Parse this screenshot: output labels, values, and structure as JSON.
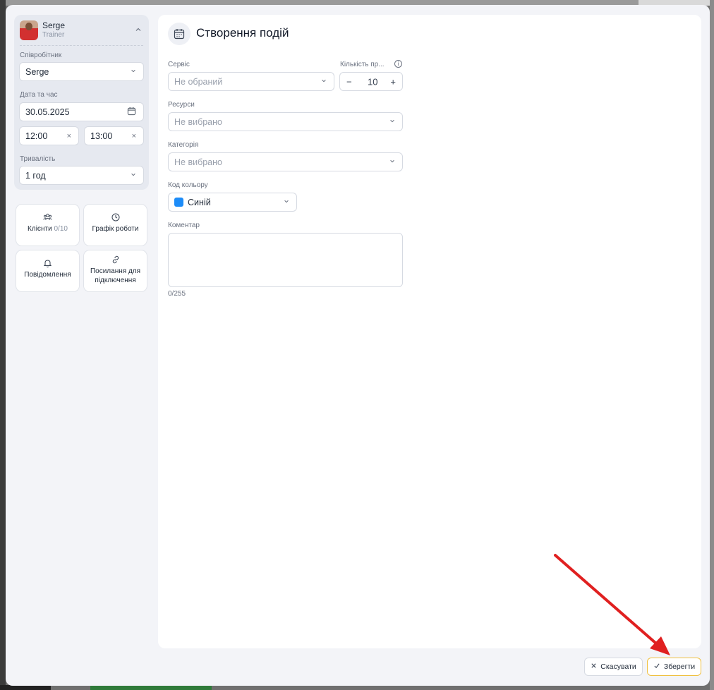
{
  "employee": {
    "name": "Serge",
    "role": "Trainer"
  },
  "left": {
    "employee_label": "Співробітник",
    "employee_value": "Serge",
    "datetime_label": "Дата та час",
    "date_value": "30.05.2025",
    "time_start": "12:00",
    "time_end": "13:00",
    "duration_label": "Тривалість",
    "duration_value": "1 год"
  },
  "tiles": [
    {
      "label": "Клієнти",
      "extra": "0/10",
      "icon": "clients-icon"
    },
    {
      "label": "Графік роботи",
      "extra": "",
      "icon": "clock-icon"
    },
    {
      "label": "Повідомлення",
      "extra": "",
      "icon": "bell-icon"
    },
    {
      "label": "Посилання для підключення",
      "extra": "",
      "icon": "link-icon"
    }
  ],
  "main": {
    "title": "Створення подій",
    "service_label": "Сервіс",
    "service_placeholder": "Не обраний",
    "count_label": "Кількість пр...",
    "count_value": "10",
    "resources_label": "Ресурси",
    "resources_placeholder": "Не вибрано",
    "category_label": "Категорія",
    "category_placeholder": "Не вибрано",
    "color_label": "Код кольору",
    "color_value": "Синій",
    "color_hex": "#1d8cf8",
    "comment_label": "Коментар",
    "comment_counter": "0/255"
  },
  "footer": {
    "cancel": "Скасувати",
    "save": "Зберегти"
  },
  "colors": {
    "accent_save_border": "#f0c040",
    "annotation_arrow": "#e02020"
  }
}
